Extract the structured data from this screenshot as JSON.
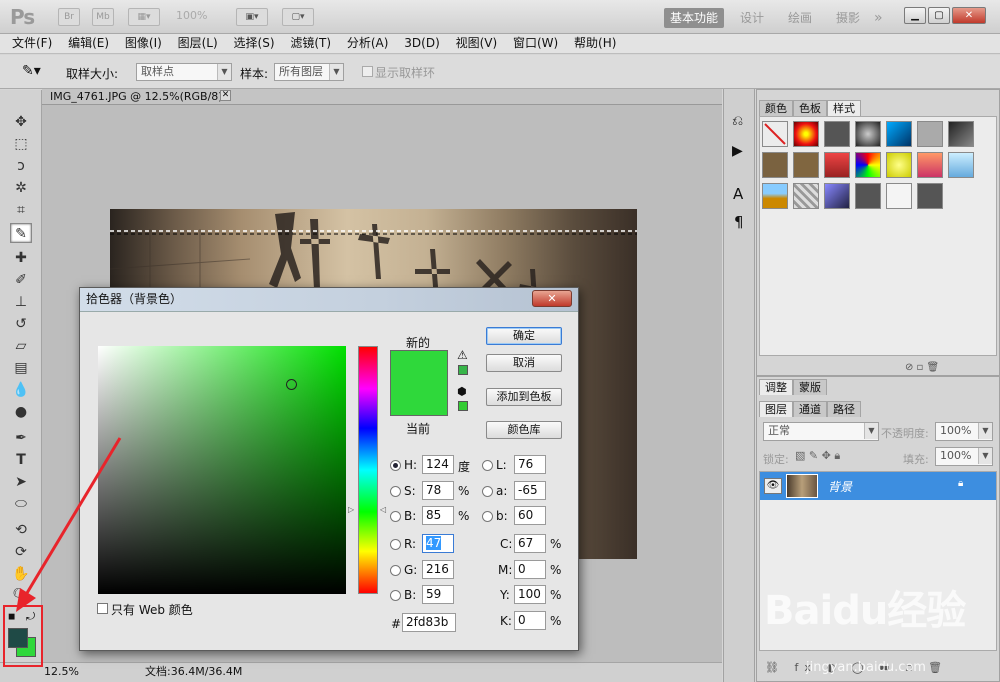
{
  "app": {
    "logo": "Ps",
    "zoom_indicator": "100%"
  },
  "titlebar": {
    "btn_br": "Br",
    "btn_mb": "Mb",
    "workspaces": [
      "基本功能",
      "设计",
      "绘画",
      "摄影"
    ],
    "more": "»"
  },
  "menu": [
    "文件(F)",
    "编辑(E)",
    "图像(I)",
    "图层(L)",
    "选择(S)",
    "滤镜(T)",
    "分析(A)",
    "3D(D)",
    "视图(V)",
    "窗口(W)",
    "帮助(H)"
  ],
  "options": {
    "sample_size_label": "取样大小:",
    "sample_size_value": "取样点",
    "sample_label": "样本:",
    "sample_value": "所有图层",
    "show_ring_label": "显示取样环"
  },
  "document": {
    "tab_title": "IMG_4761.JPG @ 12.5%(RGB/8)"
  },
  "status": {
    "zoom": "12.5%",
    "doc_info": "文档:36.4M/36.4M"
  },
  "styles_panel": {
    "tabs": [
      "颜色",
      "色板",
      "样式"
    ],
    "active_tab": "样式"
  },
  "layers_panel": {
    "top_tabs": [
      "调整",
      "蒙版"
    ],
    "tabs": [
      "图层",
      "通道",
      "路径"
    ],
    "blend_mode": "正常",
    "opacity_label": "不透明度:",
    "opacity_value": "100%",
    "lock_label": "锁定:",
    "fill_label": "填充:",
    "fill_value": "100%",
    "layer_name": "背景"
  },
  "dialog": {
    "title": "拾色器（背景色）",
    "new_label": "新的",
    "current_label": "当前",
    "new_color": "#2fd83b",
    "current_color": "#2fd83b",
    "buttons": {
      "ok": "确定",
      "cancel": "取消",
      "add_swatch": "添加到色板",
      "library": "颜色库"
    },
    "web_only_label": "只有 Web 颜色",
    "fields": {
      "H": {
        "label": "H:",
        "value": "124",
        "unit": "度"
      },
      "S": {
        "label": "S:",
        "value": "78",
        "unit": "%"
      },
      "Bv": {
        "label": "B:",
        "value": "85",
        "unit": "%"
      },
      "R": {
        "label": "R:",
        "value": "47"
      },
      "G": {
        "label": "G:",
        "value": "216"
      },
      "Bc": {
        "label": "B:",
        "value": "59"
      },
      "L": {
        "label": "L:",
        "value": "76"
      },
      "a": {
        "label": "a:",
        "value": "-65"
      },
      "b": {
        "label": "b:",
        "value": "60"
      },
      "C": {
        "label": "C:",
        "value": "67",
        "unit": "%"
      },
      "M": {
        "label": "M:",
        "value": "0",
        "unit": "%"
      },
      "Y": {
        "label": "Y:",
        "value": "100",
        "unit": "%"
      },
      "K": {
        "label": "K:",
        "value": "0",
        "unit": "%"
      },
      "hex_label": "#",
      "hex": "2fd83b"
    }
  },
  "swatches": {
    "foreground": "#1f4a46",
    "background": "#2fd83b"
  },
  "watermark": {
    "brand": "Baidu经验",
    "url": "jingyan.baidu.com"
  }
}
